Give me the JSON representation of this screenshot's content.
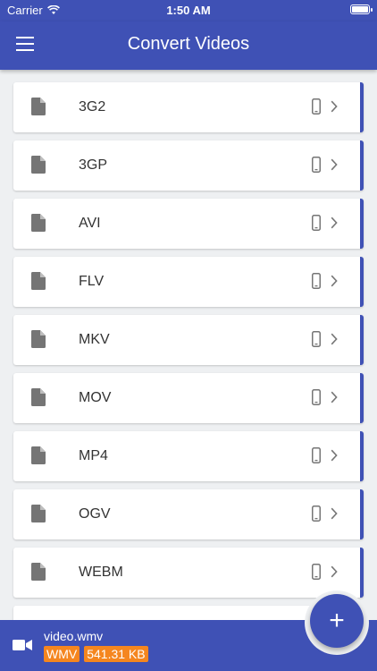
{
  "status_bar": {
    "carrier": "Carrier",
    "time": "1:50 AM"
  },
  "app_bar": {
    "title": "Convert Videos",
    "menu_icon": "hamburger-menu-icon"
  },
  "formats": [
    {
      "label": "3G2"
    },
    {
      "label": "3GP"
    },
    {
      "label": "AVI"
    },
    {
      "label": "FLV"
    },
    {
      "label": "MKV"
    },
    {
      "label": "MOV"
    },
    {
      "label": "MP4"
    },
    {
      "label": "OGV"
    },
    {
      "label": "WEBM"
    }
  ],
  "current_file": {
    "name": "video.wmv",
    "format_badge": "WMV",
    "size_badge": "541.31 KB"
  },
  "fab": {
    "label": "+"
  },
  "colors": {
    "primary": "#3f51b5",
    "badge": "#f5861f",
    "background": "#eef0f2"
  }
}
